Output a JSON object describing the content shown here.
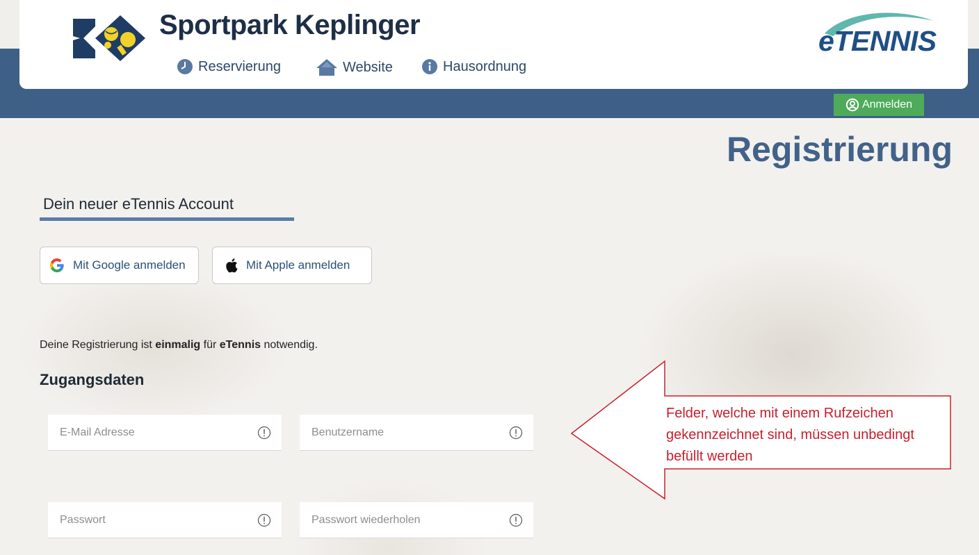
{
  "header": {
    "site_title": "Sportpark Keplinger",
    "brand": "eTENNIS",
    "nav": [
      {
        "label": "Reservierung",
        "icon": "clock-icon"
      },
      {
        "label": "Website",
        "icon": "home-icon"
      },
      {
        "label": "Hausordnung",
        "icon": "info-icon"
      }
    ],
    "login_label": "Anmelden"
  },
  "page": {
    "title": "Registrierung",
    "account_title": "Dein neuer eTennis Account",
    "google_label": "Mit Google anmelden",
    "apple_label": "Mit Apple anmelden",
    "intro": {
      "part1": "Deine Registrierung ist ",
      "bold1": "einmalig",
      "part2": " für ",
      "bold2": "eTennis",
      "part3": " notwendig."
    },
    "section_title": "Zugangsdaten",
    "fields": {
      "email_placeholder": "E-Mail Adresse",
      "username_placeholder": "Benutzername",
      "password_placeholder": "Passwort",
      "password_repeat_placeholder": "Passwort wiederholen"
    }
  },
  "annotation": {
    "text": "Felder, welche mit einem Rufzeichen gekennzeichnet sind, müssen unbedingt befüllt werden"
  },
  "colors": {
    "header_band": "#3e5f86",
    "login_button": "#4eab5a",
    "title": "#416289",
    "annotation": "#c8202c"
  }
}
